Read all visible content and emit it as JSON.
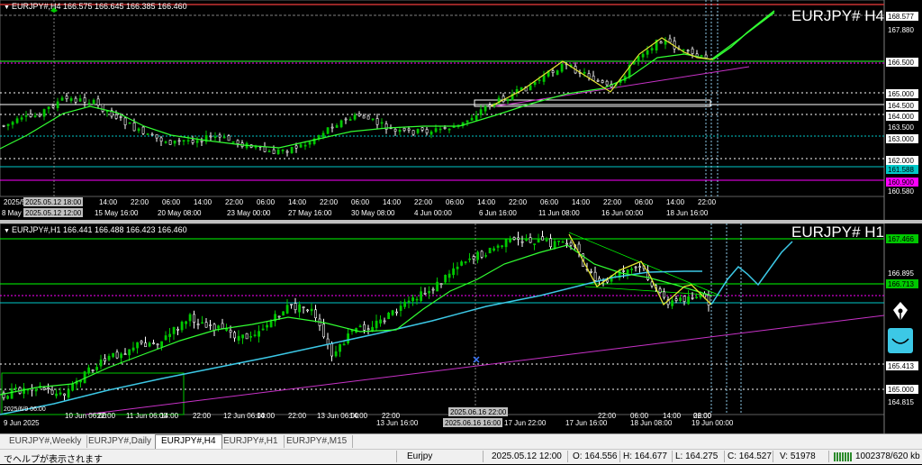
{
  "colors": {
    "bull": "#00c800",
    "bear": "#ffffff",
    "ma_green": "#32ff32",
    "ma_cyan": "#3cc8e6",
    "zigzag": "#e6e632",
    "trend": "#c832c8",
    "level_cyan": "#00c8c8",
    "level_magenta": "#ff00ff",
    "level_green": "#00ff00"
  },
  "top": {
    "info": "EURJPY#,H4 166.575 166.645 166.385 166.460",
    "title": "EURJPY# H4",
    "price_labels": [
      {
        "text": "168.577",
        "style": "box"
      },
      {
        "text": "167.880",
        "style": "plain"
      },
      {
        "text": "166.500",
        "style": "box"
      },
      {
        "text": "165.000",
        "style": "box"
      },
      {
        "text": "164.500",
        "style": "box"
      },
      {
        "text": "164.000",
        "style": "box"
      },
      {
        "text": "163.500",
        "style": "plain"
      },
      {
        "text": "163.000",
        "style": "box"
      },
      {
        "text": "162.000",
        "style": "box"
      },
      {
        "text": "161.588",
        "style": "cyan"
      },
      {
        "text": "160.900",
        "style": "magenta"
      },
      {
        "text": "160.580",
        "style": "plain"
      }
    ],
    "time_labels_row1": [
      "2025/5",
      "2025.05.12 18:00",
      "14:00",
      "22:00",
      "06:00",
      "14:00",
      "22:00",
      "06:00",
      "14:00",
      "22:00",
      "06:00",
      "14:00",
      "22:00",
      "06:00",
      "14:00",
      "22:00",
      "06:00",
      "14:00",
      "22:00",
      "06:00",
      "14:00",
      "22:00"
    ],
    "time_labels_row2": [
      "8 May",
      "2025.05.12 12:00",
      "15 May 16:00",
      "20 May 08:00",
      "23 May 00:00",
      "27 May 16:00",
      "30 May 08:00",
      "4 Jun 00:00",
      "6 Jun 16:00",
      "11 Jun 08:00",
      "16 Jun 00:00",
      "18 Jun 16:00"
    ]
  },
  "bottom": {
    "info": "EURJPY#,H1 166.441 166.488 166.423 166.460",
    "title": "EURJPY# H1",
    "price_labels": [
      {
        "text": "167.466",
        "style": "green"
      },
      {
        "text": "166.895",
        "style": "plain"
      },
      {
        "text": "166.713",
        "style": "green"
      },
      {
        "text": "165.413",
        "style": "box"
      },
      {
        "text": "165.000",
        "style": "box"
      },
      {
        "text": "164.815",
        "style": "plain"
      }
    ],
    "time_labels": [
      "9 Jun 2025",
      "2025/6/9 06:00",
      "10 Jun 06:00",
      "22:00",
      "11 Jun 06:00",
      "14:00",
      "22:00",
      "12 Jun 06:00",
      "14:00",
      "22:00",
      "13 Jun 06:00",
      "14:00",
      "22:00",
      "13 Jun 16:00",
      "2025.06.16 22:00",
      "2025.06.16 16:00",
      "17 Jun 22:00",
      "17 Jun 16:00",
      "22:00",
      "06:00",
      "14:00",
      "22:00",
      "18 Jun 08:00",
      "06:00",
      "19 Jun 00:00"
    ]
  },
  "tabs": [
    "EURJPY#,Weekly",
    "EURJPY#,Daily",
    "EURJPY#,H4",
    "EURJPY#,H1",
    "EURJPY#,M15"
  ],
  "active_tab": 2,
  "status": {
    "help": "でヘルプが表示されます",
    "profile": "Eurjpy",
    "datetime": "2025.05.12 12:00",
    "open": "O: 164.556",
    "high": "H: 164.677",
    "low": "L: 164.275",
    "close": "C: 164.527",
    "volume": "V: 51978",
    "traffic": "1002378/620 kb"
  }
}
